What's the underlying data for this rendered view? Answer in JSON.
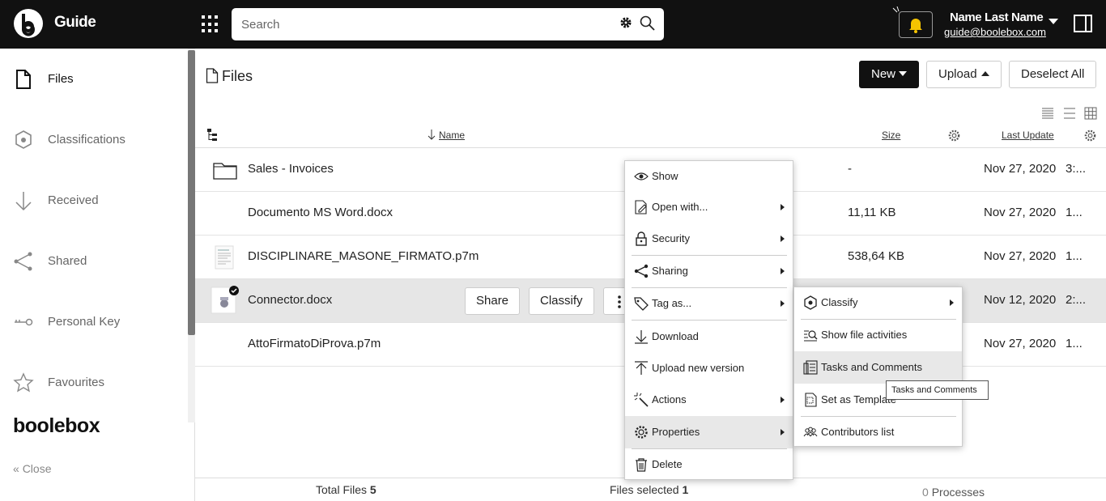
{
  "app": {
    "title": "Guide"
  },
  "search": {
    "placeholder": "Search"
  },
  "user": {
    "name": "Name Last Name",
    "email": "guide@boolebox.com"
  },
  "sidebar": {
    "items": [
      {
        "label": "Files",
        "icon": "file-icon",
        "active": true
      },
      {
        "label": "Classifications",
        "icon": "hexagon-icon"
      },
      {
        "label": "Received",
        "icon": "arrow-down-icon"
      },
      {
        "label": "Shared",
        "icon": "share-icon"
      },
      {
        "label": "Personal Key",
        "icon": "key-icon"
      },
      {
        "label": "Favourites",
        "icon": "star-icon"
      }
    ],
    "brand": "boolebox",
    "close_label": "Close"
  },
  "main": {
    "title": "Files",
    "buttons": {
      "new": "New",
      "upload": "Upload",
      "deselect": "Deselect All"
    },
    "columns": {
      "name": "Name",
      "size": "Size",
      "last_update": "Last Update"
    },
    "rows": [
      {
        "name": "Sales - Invoices",
        "size": "-",
        "date": "Nov 27, 2020",
        "time": "3:..."
      },
      {
        "name": "Documento MS Word.docx",
        "size": "11,11 KB",
        "date": "Nov 27, 2020",
        "time": "1..."
      },
      {
        "name": "DISCIPLINARE_MASONE_FIRMATO.p7m",
        "size": "538,64 KB",
        "date": "Nov 27, 2020",
        "time": "1..."
      },
      {
        "name": "Connector.docx",
        "size": "",
        "date": "Nov 12, 2020",
        "time": "2:...",
        "selected": true,
        "actions": [
          "Share",
          "Classify"
        ]
      },
      {
        "name": "AttoFirmatoDiProva.p7m",
        "size": "",
        "date": "Nov 27, 2020",
        "time": "1..."
      }
    ]
  },
  "footer": {
    "total_label": "Total Files",
    "total_value": "5",
    "selected_label": "Files selected",
    "selected_value": "1",
    "processes_value": "0",
    "processes_label": "Processes"
  },
  "context_menu": {
    "items": [
      "Show",
      "Open with...",
      "Security",
      "Sharing",
      "Tag as...",
      "Download",
      "Upload new version",
      "Actions",
      "Properties",
      "Delete"
    ]
  },
  "submenu": {
    "items": [
      "Classify",
      "Show file activities",
      "Tasks and Comments",
      "Set as Template",
      "Contributors list"
    ]
  },
  "tooltip": {
    "text": "Tasks and Comments"
  },
  "colors": {
    "topbar": "#111111",
    "accent_bell": "#f5c400",
    "selected_row": "#e6e6e6"
  }
}
